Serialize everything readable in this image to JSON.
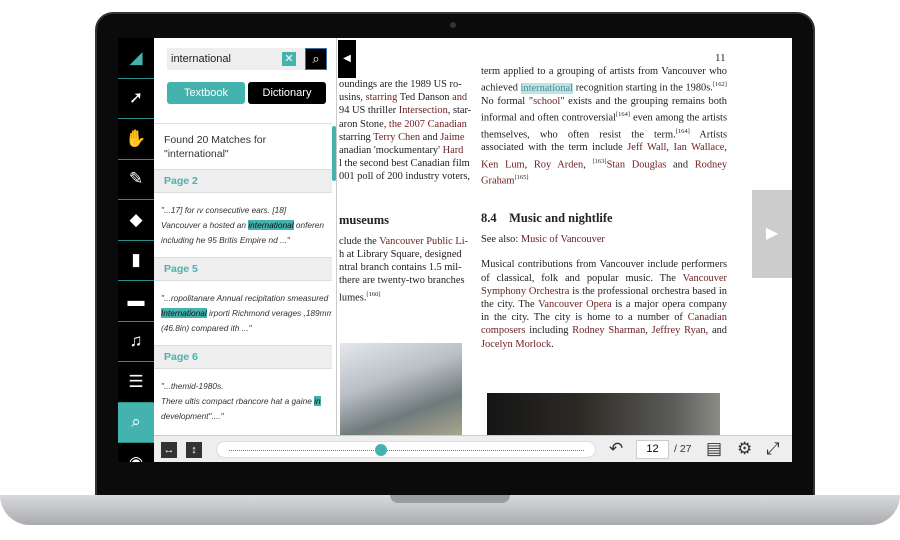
{
  "toolbar": {
    "items": [
      {
        "name": "logo",
        "glyph": "◢"
      },
      {
        "name": "select",
        "glyph": "➚"
      },
      {
        "name": "pan",
        "glyph": "✋"
      },
      {
        "name": "pen",
        "glyph": "✎"
      },
      {
        "name": "eraser",
        "glyph": "◆"
      },
      {
        "name": "bookmark",
        "glyph": "▮"
      },
      {
        "name": "comments",
        "glyph": "▬"
      },
      {
        "name": "text-audio",
        "glyph": "♫"
      },
      {
        "name": "table-of-contents",
        "glyph": "☰"
      },
      {
        "name": "search",
        "glyph": "⌕",
        "active": true
      },
      {
        "name": "view",
        "glyph": "◉"
      }
    ]
  },
  "search": {
    "query": "international",
    "clear": "✕",
    "go": "⌕",
    "tabs": {
      "textbook": "Textbook",
      "dictionary": "Dictionary"
    },
    "found": "Found 20 Matches for \"international\"",
    "results": [
      {
        "page": "Page 2",
        "l1": "\"...17]        for ıv  consecutive  ears.          [18]",
        "l2a": "Vancouver  a  hosted   an ",
        "hl": "international",
        "l2b": " onferen",
        "l3": "including he 95 Britis Empire nd ...\""
      },
      {
        "page": "Page 5",
        "l1": "\"...ropolitanare   Annual  recipitation  smeasured",
        "l2a": "",
        "hl": "International",
        "l2b": " irporti  Richmond  verages  ,189mm",
        "l3": "(46.8in) compared   ith ...\""
      },
      {
        "page": "Page 6",
        "l1": "\"...themid-1980s.",
        "l2a": "There  ultis  compact  rbancore hat  a  gaine ",
        "hl": "in",
        "l2b": "",
        "l3": "development\"....\""
      }
    ]
  },
  "document": {
    "page_number": "11",
    "col1": [
      [
        "oundings are the 1989 US ro-"
      ],
      [
        "usins",
        ", starring ",
        "Ted Danson",
        " and"
      ],
      [
        "94 US thriller ",
        "Intersection",
        ", star-"
      ],
      [
        "aron Stone",
        ", the 2007 Canadian"
      ],
      [
        "starring ",
        "Terry Chen",
        " and ",
        "Jaime"
      ],
      [
        "anadian 'mockumentary' ",
        "Hard"
      ],
      [
        "l the second best Canadian film"
      ],
      [
        "001 poll of 200 industry voters,"
      ]
    ],
    "col1_heading": "museums",
    "col1_p2": [
      [
        "clude the ",
        "Vancouver Public Li-"
      ],
      [
        "h at Library Square, designed"
      ],
      [
        "ntral branch contains 1.5 mil-"
      ],
      [
        "there are twenty-two branches"
      ],
      [
        "lumes."
      ]
    ],
    "col1_ref": "[160]",
    "col2_p1": {
      "a": "term applied to a grouping of artists from Vancouver who achieved ",
      "hl": "international",
      "b": " recognition starting in the 1980s.",
      "r1": "[162]",
      "c": " No formal \"",
      "school": "school",
      "d": "\" exists and the grouping remains both informal and often controversial",
      "r2": "[164]",
      "e": " even among the artists themselves, who often resist the term.",
      "r3": "[164]",
      "f": " Artists associated with the term include ",
      "n1": "Jeff Wall",
      ", ": ", ",
      "n2": "Ian Wallace",
      "n3": "Ken Lum",
      "n4": "Roy Arden",
      "r4": "[163]",
      "n5": "Stan Douglas",
      "and": " and ",
      "n6": "Rodney Graham",
      "r5": "[165]"
    },
    "section": {
      "num": "8.4",
      "title": "Music and nightlife"
    },
    "see_also": {
      "label": "See also: ",
      "link": "Music of Vancouver"
    },
    "music": {
      "a": "Musical contributions from Vancouver include performers of classical, folk and popular music. The ",
      "l1": "Vancouver Symphony Orchestra",
      "b": " is the professional orchestra based in the city.  The ",
      "l2": "Vancouver Opera",
      "c": " is a major opera company in the city. The city is home to a number of ",
      "l3": "Canadian composers",
      "d": " including ",
      "l4": "Rodney Sharman",
      ", ": ", ",
      "l5": "Jeffrey Ryan",
      "e": ", and ",
      "l6": "Jocelyn Morlock",
      "f": "."
    }
  },
  "bottombar": {
    "fit_width": "↔",
    "fit_height": "↕",
    "progress_page": 12,
    "current_page": "12",
    "total_pages": "/ 27",
    "undo": "↶",
    "two_page": "▤",
    "settings": "⚙",
    "fullscreen": "⤢"
  },
  "colors": {
    "accent": "#45b3ad",
    "link": "#6b1f1f",
    "highlight": "#bfe3e3"
  }
}
